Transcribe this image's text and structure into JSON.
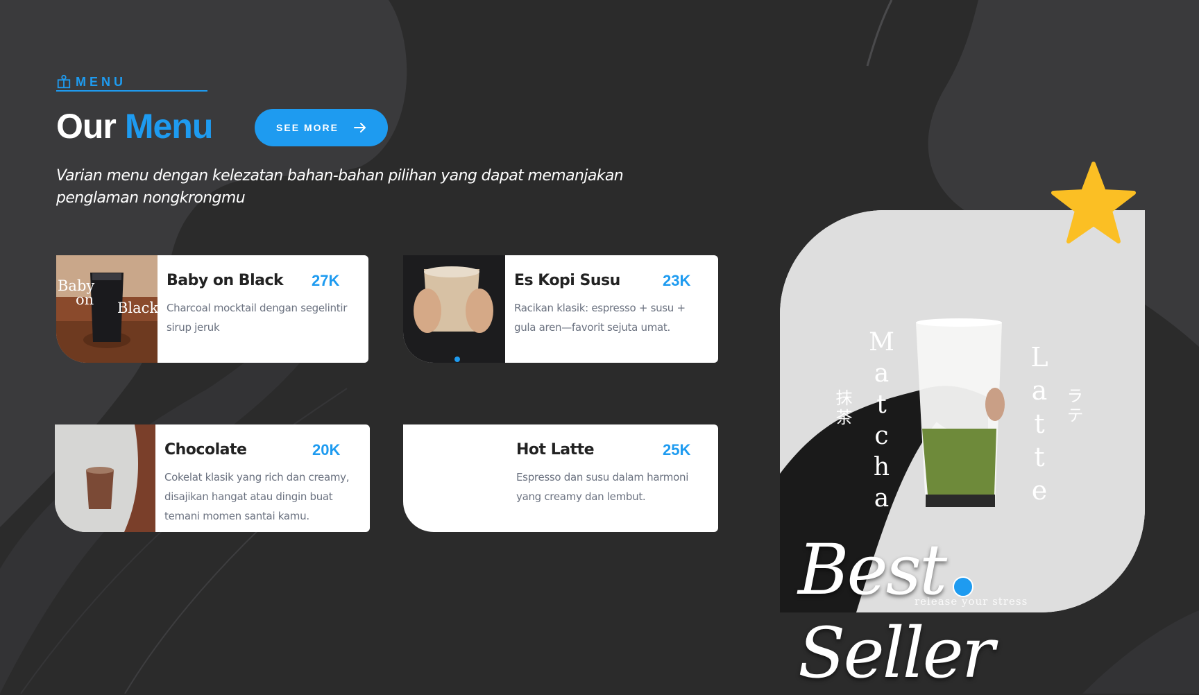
{
  "colors": {
    "background": "#2b2b2b",
    "accent": "#1e9bf0",
    "card": "#ffffff",
    "star": "#fbbf24"
  },
  "header": {
    "section_label": "MENU",
    "section_icon": "menu-book-icon",
    "title_plain": "Our",
    "title_accent": "Menu",
    "see_more_label": "SEE MORE",
    "see_more_icon": "arrow-right-icon",
    "subtitle": "Varian menu dengan kelezatan bahan-bahan pilihan yang dapat memanjakan penglaman nongkrongmu"
  },
  "menu": [
    {
      "name": "Baby on Black",
      "price": "27K",
      "description": "Charcoal mocktail dengan segelintir sirup jeruk",
      "image_text_1": "Baby",
      "image_text_2": "on",
      "image_text_3": "Black"
    },
    {
      "name": "Es Kopi Susu",
      "price": "23K",
      "description": "Racikan klasik: espresso + susu + gula aren—favorit sejuta umat."
    },
    {
      "name": "Chocolate",
      "price": "20K",
      "description": "Cokelat klasik yang rich dan creamy, disajikan hangat atau dingin buat temani momen santai kamu."
    },
    {
      "name": "Hot Latte",
      "price": "25K",
      "description": "Espresso dan susu dalam harmoni yang creamy dan lembut."
    }
  ],
  "promo": {
    "product_line_1": "Matcha",
    "product_line_2": "Latte",
    "japanese_1": "抹茶",
    "japanese_2": "ラテ",
    "tagline": "release your stress",
    "label": "Best Seller",
    "star_icon": "star-icon"
  }
}
